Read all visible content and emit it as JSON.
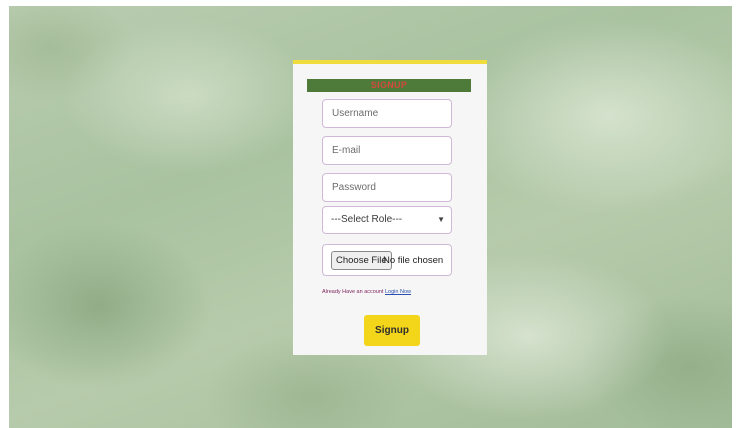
{
  "form": {
    "title": "SIGNUP",
    "username_placeholder": "Username",
    "email_placeholder": "E-mail",
    "password_placeholder": "Password",
    "role_select": {
      "selected": "---Select Role---"
    },
    "file_input": {
      "button_label": "Choose File",
      "status": "No file chosen"
    },
    "login_prompt": "Already Have an account",
    "login_link": "Login Now",
    "submit_label": "Signup"
  },
  "colors": {
    "title_bar": "#4e7a3a",
    "title_text": "#d44a3c",
    "card_accent": "#f0dc3c",
    "submit_button": "#f3d51a",
    "link": "#2a4fb0"
  },
  "icons": {
    "select_arrow": "chevron-down-icon"
  }
}
